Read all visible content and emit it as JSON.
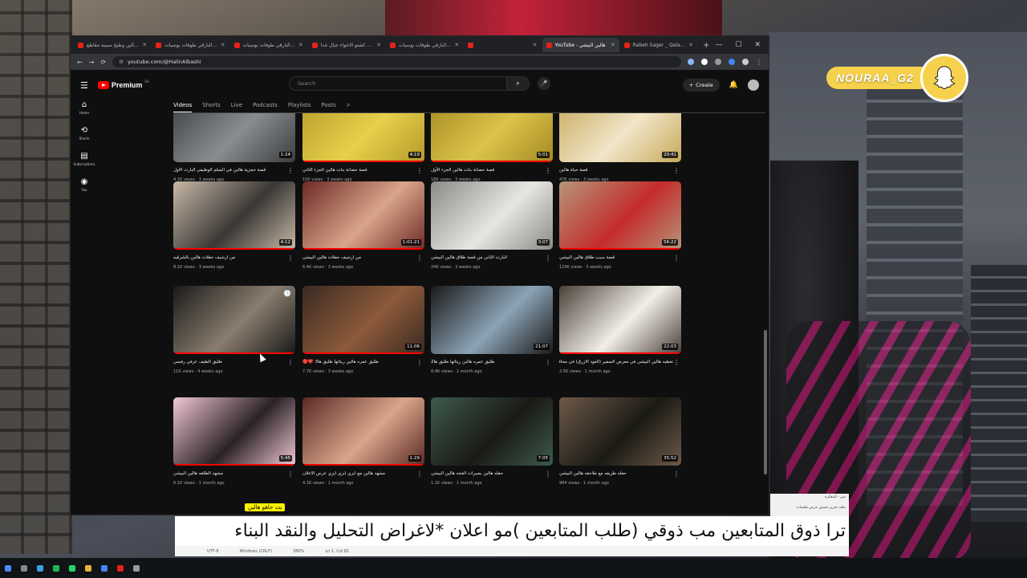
{
  "overlay_tag": "NOURAA_G2",
  "tabs": [
    {
      "title": "طليق هالين وطبخ صينية مقاطع..",
      "active": false
    },
    {
      "title": "حسين البارقي طوفات يوسيات -",
      "active": false
    },
    {
      "title": "حسين البارقي طوفات يوسيات -",
      "active": false
    },
    {
      "title": "طليق كشتو الاجواء جيال جداً -",
      "active": false
    },
    {
      "title": "حسين البارقي طوفات يوسيات -",
      "active": false
    },
    {
      "title": "",
      "active": false
    },
    {
      "title": "YouTube - هالين البيشي",
      "active": true
    },
    {
      "title": "Rabeh Sager _ Qalam - 2021",
      "active": false
    }
  ],
  "url": "youtube.com/@HalinAlbashi",
  "youtube": {
    "logo_text": "Premium",
    "logo_sup": "SA",
    "search_placeholder": "Search",
    "create_label": "Create",
    "sidebar": [
      {
        "icon": "⌂",
        "label": "Home"
      },
      {
        "icon": "⟲",
        "label": "Shorts"
      },
      {
        "icon": "▤",
        "label": "Subscriptions"
      },
      {
        "icon": "◉",
        "label": "You"
      }
    ],
    "chips": [
      "Videos",
      "Shorts",
      "Live",
      "Podcasts",
      "Playlists",
      "Posts"
    ],
    "active_chip": "Videos"
  },
  "videos": [
    {
      "title": "قصة حجزية هالين في السلم الوظيفي البارت الاول",
      "views": "4.1K views",
      "age": "3 weeks ago",
      "duration": "1:24",
      "colors": [
        "#3b3d3f",
        "#8a8d90"
      ],
      "progress": false
    },
    {
      "title": "قصة حصانة بنات هالين الجزء الثاني",
      "views": "15K views",
      "age": "3 weeks ago",
      "duration": "4:19",
      "colors": [
        "#b59a2a",
        "#e8cf4a"
      ],
      "progress": true
    },
    {
      "title": "قصة حصانة بنات هالين الجزء الأول",
      "views": "18K views",
      "age": "3 weeks ago",
      "duration": "5:01",
      "colors": [
        "#a58a22",
        "#dcc24a"
      ],
      "progress": true
    },
    {
      "title": "قصة حياة هالين",
      "views": "47K views",
      "age": "3 weeks ago",
      "duration": "20:41",
      "colors": [
        "#c7a85a",
        "#f1e6c9"
      ],
      "progress": false
    },
    {
      "title": "من ارشيف حفلات هالين بالشرقيه",
      "views": "8.1K views",
      "age": "3 weeks ago",
      "duration": "4:12",
      "colors": [
        "#c8b9a8",
        "#3a3734"
      ],
      "progress": true
    },
    {
      "title": "من ارشيف حفلات هالين البيشي",
      "views": "6.4K views",
      "age": "3 weeks ago",
      "duration": "1:01:21",
      "colors": [
        "#6d2a26",
        "#d9a58a"
      ],
      "progress": true
    },
    {
      "title": "البارت الثاني من قصة طلاق هالين البيشي",
      "views": "24K views",
      "age": "3 weeks ago",
      "duration": "3:07",
      "colors": [
        "#8c8a86",
        "#e8e6e1"
      ],
      "progress": false
    },
    {
      "title": "قصة سبب طلاق هالين البيشي",
      "views": "124K views",
      "age": "3 weeks ago",
      "duration": "56:22",
      "colors": [
        "#b59678",
        "#c42b2b"
      ],
      "progress": true
    },
    {
      "title": "طليق الطيف عرفي رفسي",
      "views": "11K views",
      "age": "4 weeks ago",
      "duration": "",
      "colors": [
        "#1a1a1a",
        "#8a7d6e"
      ],
      "progress": true
    },
    {
      "title": "طليق عمره هالين ريتاتها طليق ها3 ❤️🔴",
      "views": "7.7K views",
      "age": "3 weeks ago",
      "duration": "11:06",
      "colors": [
        "#3a2a22",
        "#8d5a3a"
      ],
      "progress": true
    },
    {
      "title": "طليق عمره هالين ريتاتها طليق ها2",
      "views": "8.4K views",
      "age": "1 month ago",
      "duration": "21:07",
      "colors": [
        "#1a1a1a",
        "#8ba3b5"
      ],
      "progress": false
    },
    {
      "title": "تعطيه هالين البيشي في معرض السفير (العود الازرق) في محافظة الخرج",
      "views": "2.5K views",
      "age": "1 month ago",
      "duration": "22:03",
      "colors": [
        "#4a4038",
        "#f2efe8"
      ],
      "progress": true
    },
    {
      "title": "مشهد الطلقه هالين البيشي",
      "views": "6.1K views",
      "age": "1 month ago",
      "duration": "5:45",
      "colors": [
        "#f2c7d4",
        "#2a2226"
      ],
      "progress": true
    },
    {
      "title": "مشهد هالين مع ايزي ايزي ايزي عرس الاعلان",
      "views": "4.1K views",
      "age": "1 month ago",
      "duration": "1:29",
      "colors": [
        "#5a2a26",
        "#d9a58a"
      ],
      "progress": true
    },
    {
      "title": "حفله هالين بصيرات الفخه هالين البيشي",
      "views": "1.1K views",
      "age": "1 month ago",
      "duration": "7:05",
      "colors": [
        "#3d5a4e",
        "#1a1a14"
      ],
      "progress": false
    },
    {
      "title": "حفله طريفه مع ملاحقه هالين البيشي",
      "views": "984 views",
      "age": "1 month ago",
      "duration": "35:52",
      "colors": [
        "#6e5a4a",
        "#1a1a14"
      ],
      "progress": false
    }
  ],
  "live_badge": "بث جاهو هالين",
  "notepad": {
    "menu": "ملف  تحرير  تنسيق  عرض  تعليمات",
    "title": "نص - المفكرة",
    "text": "ترا ذوق المتابعين مب ذوقي (طلب المتابعين )مو اعلان *لاغراض التحليل والنقد البناء",
    "status": [
      "UTF-8",
      "Windows (CRLF)",
      "380%",
      "Ln 1, Col 81"
    ]
  }
}
